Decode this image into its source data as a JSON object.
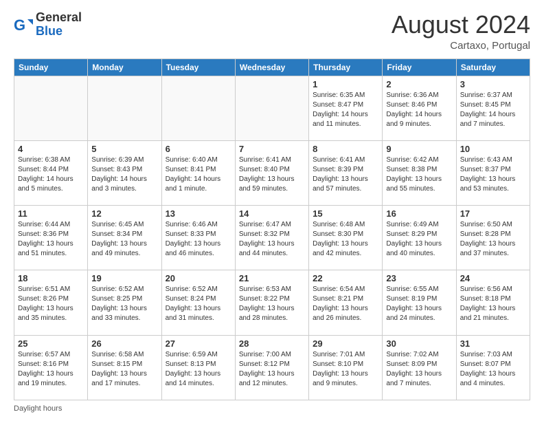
{
  "logo": {
    "text_general": "General",
    "text_blue": "Blue"
  },
  "title": {
    "month_year": "August 2024",
    "location": "Cartaxo, Portugal"
  },
  "days_of_week": [
    "Sunday",
    "Monday",
    "Tuesday",
    "Wednesday",
    "Thursday",
    "Friday",
    "Saturday"
  ],
  "weeks": [
    [
      {
        "day": "",
        "info": ""
      },
      {
        "day": "",
        "info": ""
      },
      {
        "day": "",
        "info": ""
      },
      {
        "day": "",
        "info": ""
      },
      {
        "day": "1",
        "info": "Sunrise: 6:35 AM\nSunset: 8:47 PM\nDaylight: 14 hours and 11 minutes."
      },
      {
        "day": "2",
        "info": "Sunrise: 6:36 AM\nSunset: 8:46 PM\nDaylight: 14 hours and 9 minutes."
      },
      {
        "day": "3",
        "info": "Sunrise: 6:37 AM\nSunset: 8:45 PM\nDaylight: 14 hours and 7 minutes."
      }
    ],
    [
      {
        "day": "4",
        "info": "Sunrise: 6:38 AM\nSunset: 8:44 PM\nDaylight: 14 hours and 5 minutes."
      },
      {
        "day": "5",
        "info": "Sunrise: 6:39 AM\nSunset: 8:43 PM\nDaylight: 14 hours and 3 minutes."
      },
      {
        "day": "6",
        "info": "Sunrise: 6:40 AM\nSunset: 8:41 PM\nDaylight: 14 hours and 1 minute."
      },
      {
        "day": "7",
        "info": "Sunrise: 6:41 AM\nSunset: 8:40 PM\nDaylight: 13 hours and 59 minutes."
      },
      {
        "day": "8",
        "info": "Sunrise: 6:41 AM\nSunset: 8:39 PM\nDaylight: 13 hours and 57 minutes."
      },
      {
        "day": "9",
        "info": "Sunrise: 6:42 AM\nSunset: 8:38 PM\nDaylight: 13 hours and 55 minutes."
      },
      {
        "day": "10",
        "info": "Sunrise: 6:43 AM\nSunset: 8:37 PM\nDaylight: 13 hours and 53 minutes."
      }
    ],
    [
      {
        "day": "11",
        "info": "Sunrise: 6:44 AM\nSunset: 8:36 PM\nDaylight: 13 hours and 51 minutes."
      },
      {
        "day": "12",
        "info": "Sunrise: 6:45 AM\nSunset: 8:34 PM\nDaylight: 13 hours and 49 minutes."
      },
      {
        "day": "13",
        "info": "Sunrise: 6:46 AM\nSunset: 8:33 PM\nDaylight: 13 hours and 46 minutes."
      },
      {
        "day": "14",
        "info": "Sunrise: 6:47 AM\nSunset: 8:32 PM\nDaylight: 13 hours and 44 minutes."
      },
      {
        "day": "15",
        "info": "Sunrise: 6:48 AM\nSunset: 8:30 PM\nDaylight: 13 hours and 42 minutes."
      },
      {
        "day": "16",
        "info": "Sunrise: 6:49 AM\nSunset: 8:29 PM\nDaylight: 13 hours and 40 minutes."
      },
      {
        "day": "17",
        "info": "Sunrise: 6:50 AM\nSunset: 8:28 PM\nDaylight: 13 hours and 37 minutes."
      }
    ],
    [
      {
        "day": "18",
        "info": "Sunrise: 6:51 AM\nSunset: 8:26 PM\nDaylight: 13 hours and 35 minutes."
      },
      {
        "day": "19",
        "info": "Sunrise: 6:52 AM\nSunset: 8:25 PM\nDaylight: 13 hours and 33 minutes."
      },
      {
        "day": "20",
        "info": "Sunrise: 6:52 AM\nSunset: 8:24 PM\nDaylight: 13 hours and 31 minutes."
      },
      {
        "day": "21",
        "info": "Sunrise: 6:53 AM\nSunset: 8:22 PM\nDaylight: 13 hours and 28 minutes."
      },
      {
        "day": "22",
        "info": "Sunrise: 6:54 AM\nSunset: 8:21 PM\nDaylight: 13 hours and 26 minutes."
      },
      {
        "day": "23",
        "info": "Sunrise: 6:55 AM\nSunset: 8:19 PM\nDaylight: 13 hours and 24 minutes."
      },
      {
        "day": "24",
        "info": "Sunrise: 6:56 AM\nSunset: 8:18 PM\nDaylight: 13 hours and 21 minutes."
      }
    ],
    [
      {
        "day": "25",
        "info": "Sunrise: 6:57 AM\nSunset: 8:16 PM\nDaylight: 13 hours and 19 minutes."
      },
      {
        "day": "26",
        "info": "Sunrise: 6:58 AM\nSunset: 8:15 PM\nDaylight: 13 hours and 17 minutes."
      },
      {
        "day": "27",
        "info": "Sunrise: 6:59 AM\nSunset: 8:13 PM\nDaylight: 13 hours and 14 minutes."
      },
      {
        "day": "28",
        "info": "Sunrise: 7:00 AM\nSunset: 8:12 PM\nDaylight: 13 hours and 12 minutes."
      },
      {
        "day": "29",
        "info": "Sunrise: 7:01 AM\nSunset: 8:10 PM\nDaylight: 13 hours and 9 minutes."
      },
      {
        "day": "30",
        "info": "Sunrise: 7:02 AM\nSunset: 8:09 PM\nDaylight: 13 hours and 7 minutes."
      },
      {
        "day": "31",
        "info": "Sunrise: 7:03 AM\nSunset: 8:07 PM\nDaylight: 13 hours and 4 minutes."
      }
    ]
  ],
  "footer": {
    "note": "Daylight hours"
  }
}
